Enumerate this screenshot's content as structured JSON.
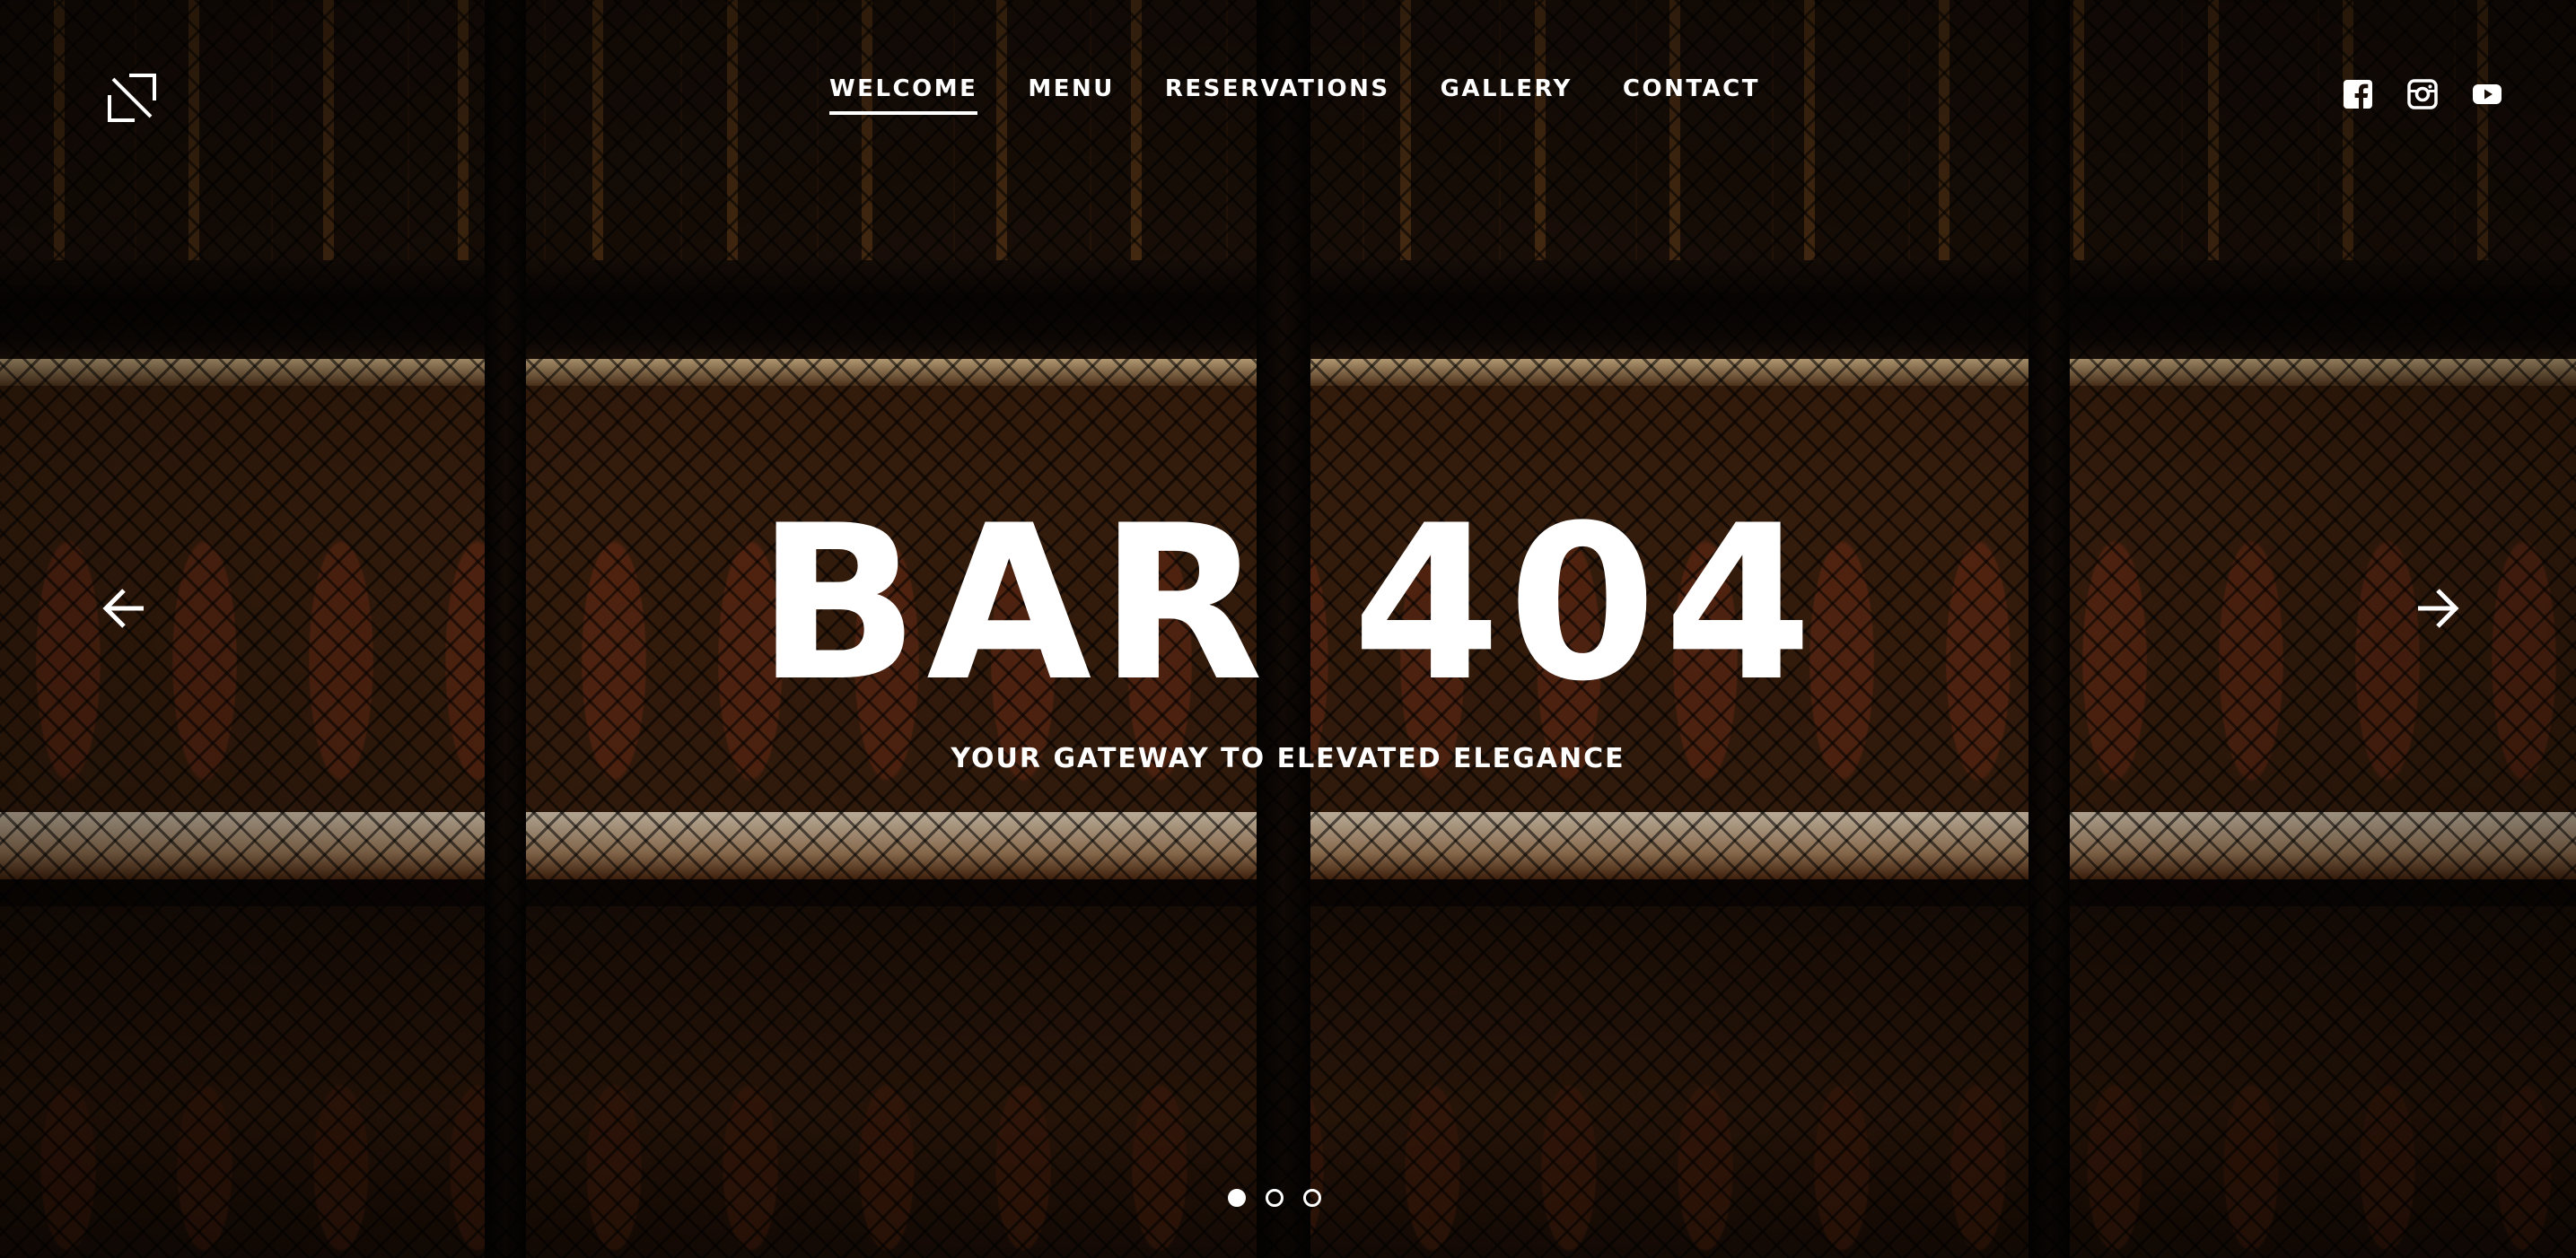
{
  "header": {
    "logo_icon": "corner-arrow-logo-icon",
    "nav": [
      {
        "label": "WELCOME",
        "active": true
      },
      {
        "label": "MENU",
        "active": false
      },
      {
        "label": "RESERVATIONS",
        "active": false
      },
      {
        "label": "GALLERY",
        "active": false
      },
      {
        "label": "CONTACT",
        "active": false
      }
    ],
    "social": [
      "facebook-icon",
      "instagram-icon",
      "youtube-icon"
    ]
  },
  "hero": {
    "title": "BAR 404",
    "subtitle": "YOUR GATEWAY TO ELEVATED ELEGANCE",
    "prev_icon": "arrow-left-icon",
    "next_icon": "arrow-right-icon"
  },
  "slider": {
    "slide_count": 3,
    "active_index": 0
  },
  "colors": {
    "text": "#ffffff",
    "background": "#120b06"
  }
}
